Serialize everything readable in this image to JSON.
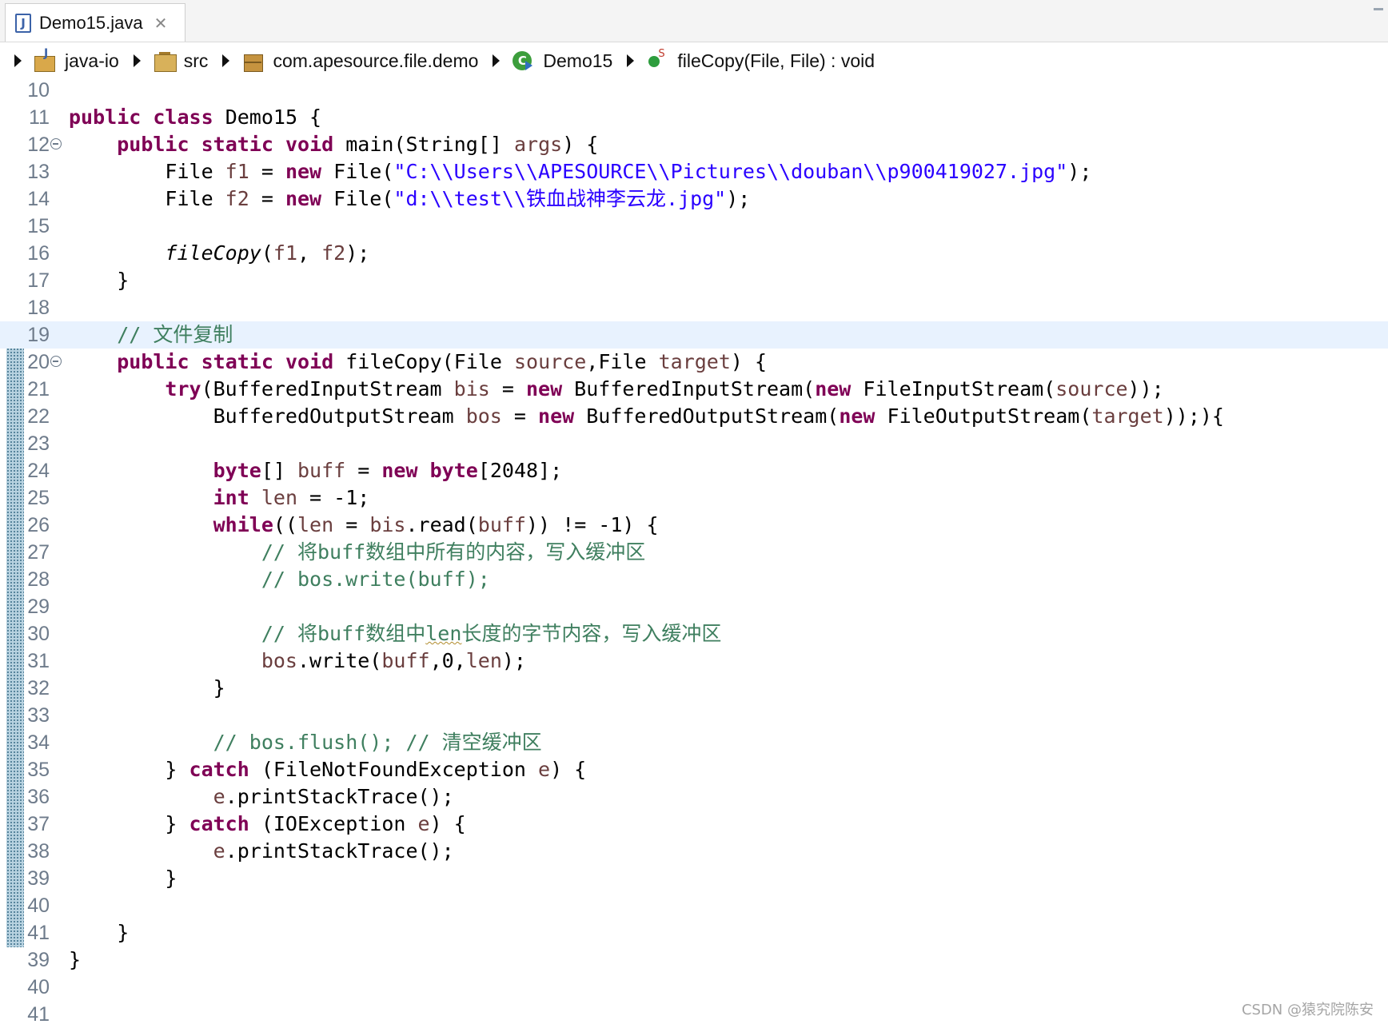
{
  "tab": {
    "title": "Demo15.java",
    "close_glyph": "✕",
    "icon": "java-file-icon",
    "icon_letter": "J"
  },
  "breadcrumb": [
    {
      "label": "java-io",
      "icon": "project-icon"
    },
    {
      "label": "src",
      "icon": "source-folder-icon"
    },
    {
      "label": "com.apesource.file.demo",
      "icon": "package-icon"
    },
    {
      "label": "Demo15",
      "icon": "class-icon",
      "icon_letter": "C"
    },
    {
      "label": "fileCopy(File, File) : void",
      "icon": "method-icon",
      "icon_mark": "S"
    }
  ],
  "editor": {
    "current_line": "19",
    "lines": [
      {
        "num": "10",
        "segs": []
      },
      {
        "num": "11",
        "segs": [
          [
            "kw",
            "public"
          ],
          [
            "t",
            " "
          ],
          [
            "kw",
            "class"
          ],
          [
            "t",
            " Demo15 {"
          ]
        ]
      },
      {
        "num": "12",
        "fold": true,
        "segs": [
          [
            "t",
            "    "
          ],
          [
            "kw",
            "public"
          ],
          [
            "t",
            " "
          ],
          [
            "kw",
            "static"
          ],
          [
            "t",
            " "
          ],
          [
            "kw",
            "void"
          ],
          [
            "t",
            " main(String[] "
          ],
          [
            "var",
            "args"
          ],
          [
            "t",
            ") {"
          ]
        ]
      },
      {
        "num": "13",
        "segs": [
          [
            "t",
            "        File "
          ],
          [
            "var",
            "f1"
          ],
          [
            "t",
            " = "
          ],
          [
            "kw",
            "new"
          ],
          [
            "t",
            " File("
          ],
          [
            "str",
            "\"C:\\\\Users\\\\APESOURCE\\\\Pictures\\\\douban\\\\p900419027.jpg\""
          ],
          [
            "t",
            ");"
          ]
        ]
      },
      {
        "num": "14",
        "segs": [
          [
            "t",
            "        File "
          ],
          [
            "var",
            "f2"
          ],
          [
            "t",
            " = "
          ],
          [
            "kw",
            "new"
          ],
          [
            "t",
            " File("
          ],
          [
            "str",
            "\"d:\\\\test\\\\铁血战神李云龙.jpg\""
          ],
          [
            "t",
            ");"
          ]
        ]
      },
      {
        "num": "15",
        "segs": []
      },
      {
        "num": "16",
        "segs": [
          [
            "t",
            "        "
          ],
          [
            "it",
            "fileCopy"
          ],
          [
            "t",
            "("
          ],
          [
            "var",
            "f1"
          ],
          [
            "t",
            ", "
          ],
          [
            "var",
            "f2"
          ],
          [
            "t",
            ");"
          ]
        ]
      },
      {
        "num": "17",
        "segs": [
          [
            "t",
            "    }"
          ]
        ]
      },
      {
        "num": "18",
        "segs": []
      },
      {
        "num": "19",
        "segs": [
          [
            "t",
            "    "
          ],
          [
            "cm",
            "// "
          ],
          [
            "cmcjk",
            "文件复制"
          ]
        ]
      },
      {
        "num": "20",
        "fold": true,
        "segs": [
          [
            "t",
            "    "
          ],
          [
            "kw",
            "public"
          ],
          [
            "t",
            " "
          ],
          [
            "kw",
            "static"
          ],
          [
            "t",
            " "
          ],
          [
            "kw",
            "void"
          ],
          [
            "t",
            " fileCopy(File "
          ],
          [
            "var",
            "source"
          ],
          [
            "t",
            ",File "
          ],
          [
            "var",
            "target"
          ],
          [
            "t",
            ") {"
          ]
        ]
      },
      {
        "num": "21",
        "segs": [
          [
            "t",
            "        "
          ],
          [
            "kw",
            "try"
          ],
          [
            "t",
            "(BufferedInputStream "
          ],
          [
            "var",
            "bis"
          ],
          [
            "t",
            " = "
          ],
          [
            "kw",
            "new"
          ],
          [
            "t",
            " BufferedInputStream("
          ],
          [
            "kw",
            "new"
          ],
          [
            "t",
            " FileInputStream("
          ],
          [
            "var",
            "source"
          ],
          [
            "t",
            "));"
          ]
        ]
      },
      {
        "num": "22",
        "segs": [
          [
            "t",
            "            BufferedOutputStream "
          ],
          [
            "var",
            "bos"
          ],
          [
            "t",
            " = "
          ],
          [
            "kw",
            "new"
          ],
          [
            "t",
            " BufferedOutputStream("
          ],
          [
            "kw",
            "new"
          ],
          [
            "t",
            " FileOutputStream("
          ],
          [
            "var",
            "target"
          ],
          [
            "t",
            "));){"
          ]
        ]
      },
      {
        "num": "23",
        "segs": []
      },
      {
        "num": "24",
        "segs": [
          [
            "t",
            "            "
          ],
          [
            "kw",
            "byte"
          ],
          [
            "t",
            "[] "
          ],
          [
            "var",
            "buff"
          ],
          [
            "t",
            " = "
          ],
          [
            "kw",
            "new"
          ],
          [
            "t",
            " "
          ],
          [
            "kw",
            "byte"
          ],
          [
            "t",
            "[2048];"
          ]
        ]
      },
      {
        "num": "25",
        "segs": [
          [
            "t",
            "            "
          ],
          [
            "kw",
            "int"
          ],
          [
            "t",
            " "
          ],
          [
            "var",
            "len"
          ],
          [
            "t",
            " = -1;"
          ]
        ]
      },
      {
        "num": "26",
        "segs": [
          [
            "t",
            "            "
          ],
          [
            "kw",
            "while"
          ],
          [
            "t",
            "(("
          ],
          [
            "var",
            "len"
          ],
          [
            "t",
            " = "
          ],
          [
            "var",
            "bis"
          ],
          [
            "t",
            ".read("
          ],
          [
            "var",
            "buff"
          ],
          [
            "t",
            ")) != -1) {"
          ]
        ]
      },
      {
        "num": "27",
        "segs": [
          [
            "t",
            "                "
          ],
          [
            "cm",
            "// "
          ],
          [
            "cmcjk",
            "将"
          ],
          [
            "cm",
            "buff"
          ],
          [
            "cmcjk",
            "数组中所有的内容，写入缓冲区"
          ]
        ]
      },
      {
        "num": "28",
        "segs": [
          [
            "t",
            "                "
          ],
          [
            "cm",
            "// bos.write(buff);"
          ]
        ]
      },
      {
        "num": "29",
        "segs": []
      },
      {
        "num": "30",
        "segs": [
          [
            "t",
            "                "
          ],
          [
            "cm",
            "// "
          ],
          [
            "cmcjk",
            "将"
          ],
          [
            "cm",
            "buff"
          ],
          [
            "cmcjk",
            "数组中"
          ],
          [
            "cmwavy",
            "len"
          ],
          [
            "cmcjk",
            "长度的字节内容，写入缓冲区"
          ]
        ]
      },
      {
        "num": "31",
        "segs": [
          [
            "t",
            "                "
          ],
          [
            "var",
            "bos"
          ],
          [
            "t",
            ".write("
          ],
          [
            "var",
            "buff"
          ],
          [
            "t",
            ",0,"
          ],
          [
            "var",
            "len"
          ],
          [
            "t",
            ");"
          ]
        ]
      },
      {
        "num": "32",
        "segs": [
          [
            "t",
            "            }"
          ]
        ]
      },
      {
        "num": "33",
        "segs": []
      },
      {
        "num": "34",
        "segs": [
          [
            "t",
            "            "
          ],
          [
            "cm",
            "// bos.flush(); // "
          ],
          [
            "cmcjk",
            "清空缓冲区"
          ]
        ]
      },
      {
        "num": "35",
        "segs": [
          [
            "t",
            "        } "
          ],
          [
            "kw",
            "catch"
          ],
          [
            "t",
            " (FileNotFoundException "
          ],
          [
            "var",
            "e"
          ],
          [
            "t",
            ") {"
          ]
        ]
      },
      {
        "num": "36",
        "segs": [
          [
            "t",
            "            "
          ],
          [
            "var",
            "e"
          ],
          [
            "t",
            ".printStackTrace();"
          ]
        ]
      },
      {
        "num": "37",
        "segs": [
          [
            "t",
            "        } "
          ],
          [
            "kw",
            "catch"
          ],
          [
            "t",
            " (IOException "
          ],
          [
            "var",
            "e"
          ],
          [
            "t",
            ") {"
          ]
        ]
      },
      {
        "num": "38",
        "segs": [
          [
            "t",
            "            "
          ],
          [
            "var",
            "e"
          ],
          [
            "t",
            ".printStackTrace();"
          ]
        ]
      },
      {
        "num": "39",
        "segs": [
          [
            "t",
            "        }"
          ]
        ]
      },
      {
        "num": "40",
        "segs": []
      },
      {
        "num": "41",
        "segs": [
          [
            "t",
            "    }"
          ]
        ]
      },
      {
        "num": "39",
        "segs": [
          [
            "t",
            "}"
          ]
        ]
      },
      {
        "num": "40",
        "segs": []
      },
      {
        "num": "41",
        "segs": []
      }
    ]
  },
  "watermark": "CSDN @猿究院陈安"
}
